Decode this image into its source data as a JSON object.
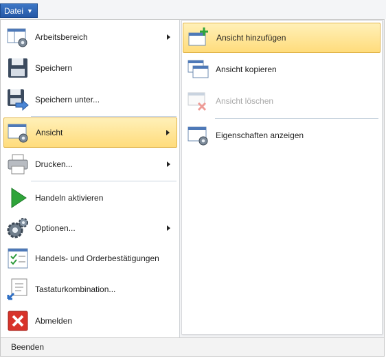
{
  "menu_button": {
    "label": "Datei"
  },
  "main_menu": {
    "items": [
      {
        "label": "Arbeitsbereich"
      },
      {
        "label": "Speichern"
      },
      {
        "label": "Speichern unter..."
      },
      {
        "label": "Ansicht"
      },
      {
        "label": "Drucken..."
      },
      {
        "label": "Handeln aktivieren"
      },
      {
        "label": "Optionen..."
      },
      {
        "label": "Handels- und Orderbestätigungen"
      },
      {
        "label": "Tastaturkombination..."
      },
      {
        "label": "Abmelden"
      }
    ]
  },
  "submenu": {
    "items": [
      {
        "label": "Ansicht hinzufügen"
      },
      {
        "label": "Ansicht kopieren"
      },
      {
        "label": "Ansicht löschen"
      },
      {
        "label": "Eigenschaften anzeigen"
      }
    ]
  },
  "footer": {
    "label": "Beenden"
  },
  "colors": {
    "highlight": "#ffe08a",
    "menu_button": "#2f67b8",
    "disabled_text": "#a8a8a8"
  }
}
